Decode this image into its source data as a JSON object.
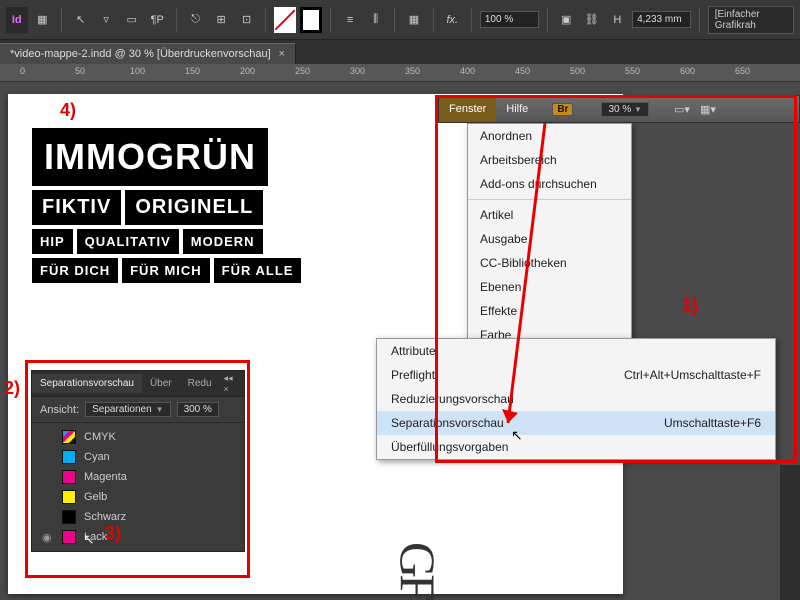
{
  "toolbar": {
    "measurement": "4,233 mm",
    "graphic_frame_label": "[Einfacher Grafikrah",
    "percent": "100 %"
  },
  "doc_tab": {
    "title": "*video-mappe-2.indd @ 30 % [Überdruckenvorschau]"
  },
  "ruler_marks": [
    "0",
    "50",
    "100",
    "150",
    "200",
    "250",
    "300",
    "350",
    "400",
    "450",
    "500",
    "550",
    "600",
    "650"
  ],
  "logo": {
    "main": "IMMOGRÜN",
    "row2": [
      "FIKTIV",
      "ORIGINELL"
    ],
    "row3": [
      "HIP",
      "QUALITATIV",
      "MODERN"
    ],
    "row4": [
      "FÜR DICH",
      "FÜR MICH",
      "FÜR ALLE"
    ]
  },
  "menubar": {
    "fenster": "Fenster",
    "hilfe": "Hilfe",
    "br": "Br",
    "zoom": "30 %"
  },
  "dropdown": {
    "items": [
      "Anordnen",
      "Arbeitsbereich",
      "Add-ons durchsuchen",
      "",
      "Artikel",
      "Ausgabe",
      "CC-Bibliotheken",
      "Ebenen",
      "Effekte",
      "Farbe"
    ]
  },
  "submenu": {
    "rows": [
      {
        "label": "Attribute",
        "shortcut": ""
      },
      {
        "label": "Preflight",
        "shortcut": "Ctrl+Alt+Umschalttaste+F"
      },
      {
        "label": "Reduzierungsvorschau",
        "shortcut": ""
      },
      {
        "label": "Separationsvorschau",
        "shortcut": "Umschalttaste+F6",
        "highlight": true
      },
      {
        "label": "Überfüllungsvorgaben",
        "shortcut": ""
      }
    ]
  },
  "sep_panel": {
    "tab_active": "Separationsvorschau",
    "tab2": "Über",
    "tab3": "Redu",
    "ansicht_label": "Ansicht:",
    "ansicht_value": "Separationen",
    "ansicht_pct": "300 %",
    "rows": [
      {
        "klass": "cmyk",
        "label": "CMYK",
        "eye": false
      },
      {
        "klass": "cyan",
        "label": "Cyan",
        "eye": false
      },
      {
        "klass": "magenta",
        "label": "Magenta",
        "eye": false
      },
      {
        "klass": "gelb",
        "label": "Gelb",
        "eye": false
      },
      {
        "klass": "schwarz",
        "label": "Schwarz",
        "eye": false
      },
      {
        "klass": "lack",
        "label": "Lack",
        "eye": true
      }
    ]
  },
  "annotations": {
    "n1": "1)",
    "n2": "2)",
    "n3": "3)",
    "n4": "4)"
  },
  "misc": {
    "gr": "GF"
  }
}
